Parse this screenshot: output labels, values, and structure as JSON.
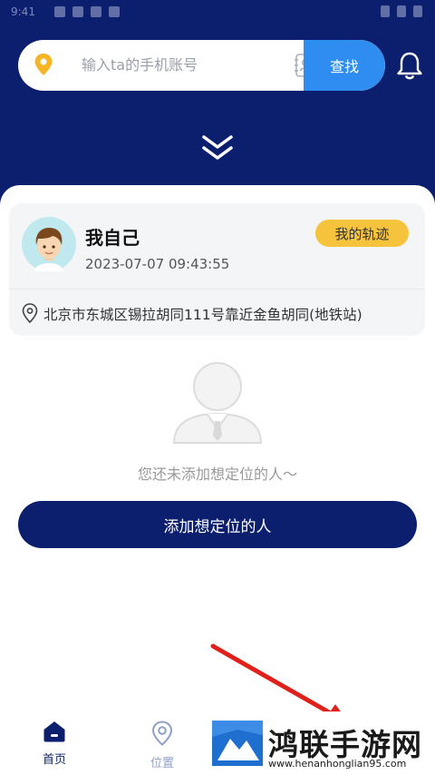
{
  "status_bar": {
    "time": "9:41"
  },
  "search": {
    "placeholder": "输入ta的手机账号",
    "button_label": "查找"
  },
  "self_card": {
    "name": "我自己",
    "timestamp": "2023-07-07 09:43:55",
    "track_button": "我的轨迹",
    "address": "北京市东城区锡拉胡同111号靠近金鱼胡同(地铁站)"
  },
  "empty_state": {
    "message": "您还未添加想定位的人～"
  },
  "add_button": {
    "label": "添加想定位的人"
  },
  "tabbar": {
    "items": [
      {
        "label": "首页"
      },
      {
        "label": "位置"
      }
    ]
  },
  "watermark": {
    "title": "鸿联手游网",
    "url": "www.henanhonglian95.com"
  },
  "colors": {
    "header_navy": "#0b1f6e",
    "search_button_blue": "#2f8cf0",
    "track_button_yellow": "#f6c33c",
    "arrow_red": "#e0201a"
  },
  "icons": [
    "location-pin-icon",
    "contacts-book-icon",
    "bell-icon",
    "double-chevron-down-icon",
    "avatar-boy",
    "location-outline-icon",
    "person-placeholder-icon",
    "home-icon",
    "location-tab-icon"
  ]
}
